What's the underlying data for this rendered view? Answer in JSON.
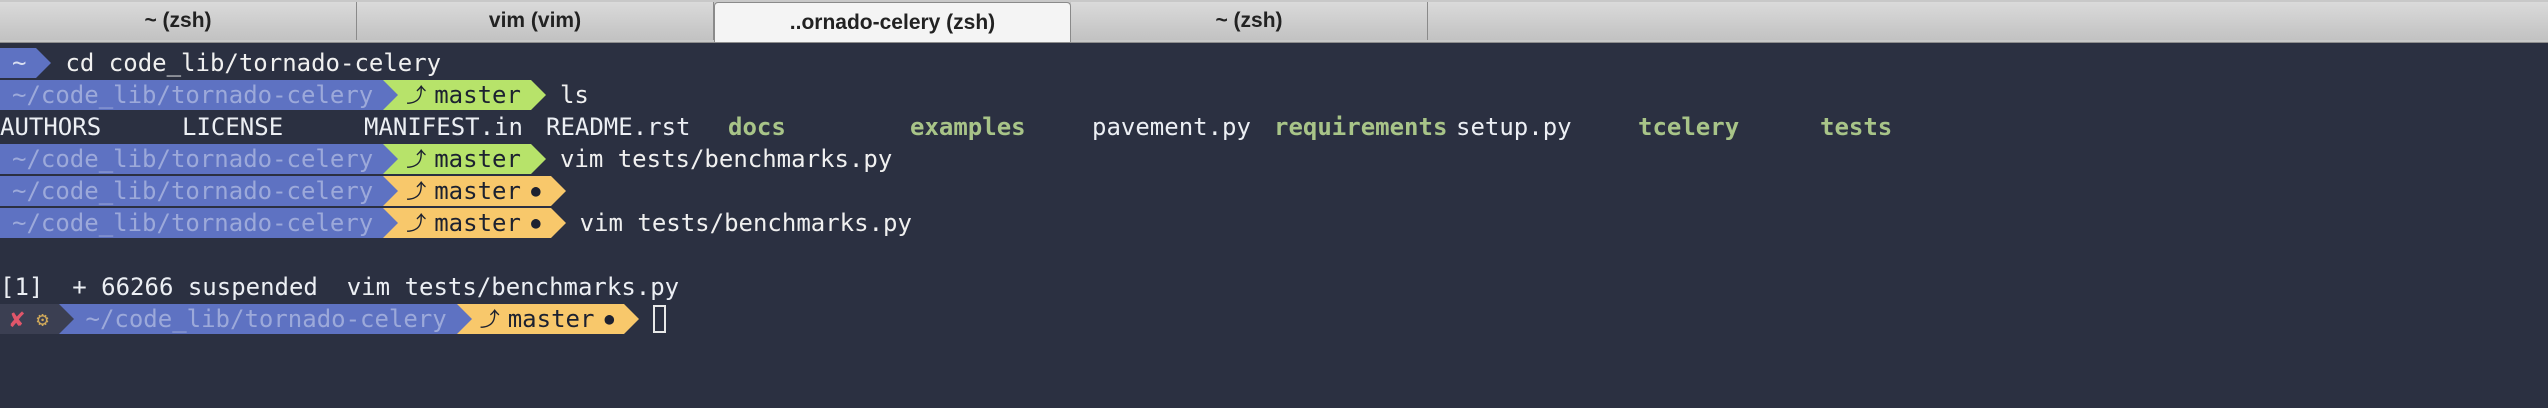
{
  "tabs": [
    {
      "label": "~ (zsh)",
      "active": false
    },
    {
      "label": "vim (vim)",
      "active": false
    },
    {
      "label": "..ornado-celery (zsh)",
      "active": true
    },
    {
      "label": "~ (zsh)",
      "active": false
    }
  ],
  "prompt": {
    "home": "~",
    "path": "~/code_lib/tornado-celery",
    "branch_icon": "⤴",
    "branch": "master",
    "dirty_marker": "●",
    "status_error": "✘",
    "status_jobs": "⚙"
  },
  "lines": [
    {
      "cmd": "cd code_lib/tornado-celery"
    },
    {
      "cmd": "ls"
    },
    {
      "cmd": "vim tests/benchmarks.py"
    },
    {
      "cmd": ""
    },
    {
      "cmd": "vim tests/benchmarks.py"
    }
  ],
  "ls_output": [
    {
      "name": "AUTHORS",
      "dir": false
    },
    {
      "name": "LICENSE",
      "dir": false
    },
    {
      "name": "MANIFEST.in",
      "dir": false
    },
    {
      "name": "README.rst",
      "dir": false
    },
    {
      "name": "docs",
      "dir": true
    },
    {
      "name": "examples",
      "dir": true
    },
    {
      "name": "pavement.py",
      "dir": false
    },
    {
      "name": "requirements",
      "dir": true
    },
    {
      "name": "setup.py",
      "dir": false
    },
    {
      "name": "tcelery",
      "dir": true
    },
    {
      "name": "tests",
      "dir": true
    }
  ],
  "job_message": "[1]  + 66266 suspended  vim tests/benchmarks.py",
  "colors": {
    "background": "#2b3041",
    "path_segment": "#5e72c2",
    "git_clean": "#b7e36a",
    "git_dirty": "#f8c86b",
    "dir_color": "#a8c488"
  }
}
